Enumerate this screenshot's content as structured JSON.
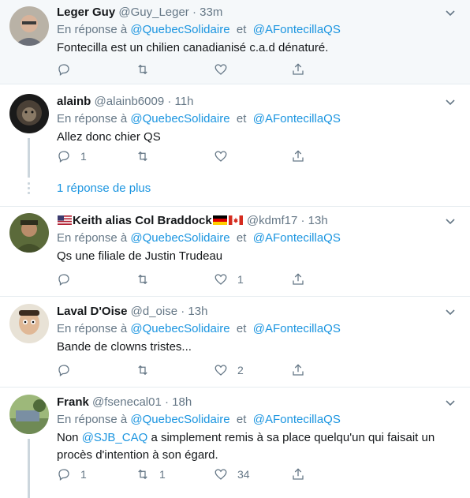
{
  "reply_prefix": "En réponse à",
  "reply_joiner": "et",
  "tweets": [
    {
      "name": "Leger Guy",
      "handle": "@Guy_Leger",
      "time": "33m",
      "mention1": "@QuebecSolidaire",
      "mention2": "@AFontecillaQS",
      "text": "Fontecilla est un chilien canadianisé c.a.d dénaturé.",
      "reply_count": "",
      "retweet_count": "",
      "like_count": ""
    },
    {
      "name": "alainb",
      "handle": "@alainb6009",
      "time": "11h",
      "mention1": "@QuebecSolidaire",
      "mention2": "@AFontecillaQS",
      "text": "Allez donc chier QS",
      "reply_count": "1",
      "retweet_count": "",
      "like_count": "",
      "more_replies": "1 réponse de plus"
    },
    {
      "name": "Keith alias Col Braddock",
      "handle": "@kdmf17",
      "time": "13h",
      "mention1": "@QuebecSolidaire",
      "mention2": "@AFontecillaQS",
      "text": "Qs une filiale de Justin Trudeau",
      "reply_count": "",
      "retweet_count": "",
      "like_count": "1"
    },
    {
      "name": "Laval D'Oise",
      "handle": "@d_oise",
      "time": "13h",
      "mention1": "@QuebecSolidaire",
      "mention2": "@AFontecillaQS",
      "text": "Bande de clowns tristes...",
      "reply_count": "",
      "retweet_count": "",
      "like_count": "2"
    },
    {
      "name": "Frank",
      "handle": "@fsenecal01",
      "time": "18h",
      "mention1": "@QuebecSolidaire",
      "mention2": "@AFontecillaQS",
      "text_prefix": "Non ",
      "text_mention": "@SJB_CAQ",
      "text_rest": " a simplement remis à sa place quelqu'un qui faisait un procès d'intention à son égard.",
      "reply_count": "1",
      "retweet_count": "1",
      "like_count": "34"
    }
  ],
  "colors": {
    "link": "#1b95e0",
    "muted": "#657786",
    "highlight_bg": "#f5f8fa",
    "border": "#e6ecf0"
  }
}
